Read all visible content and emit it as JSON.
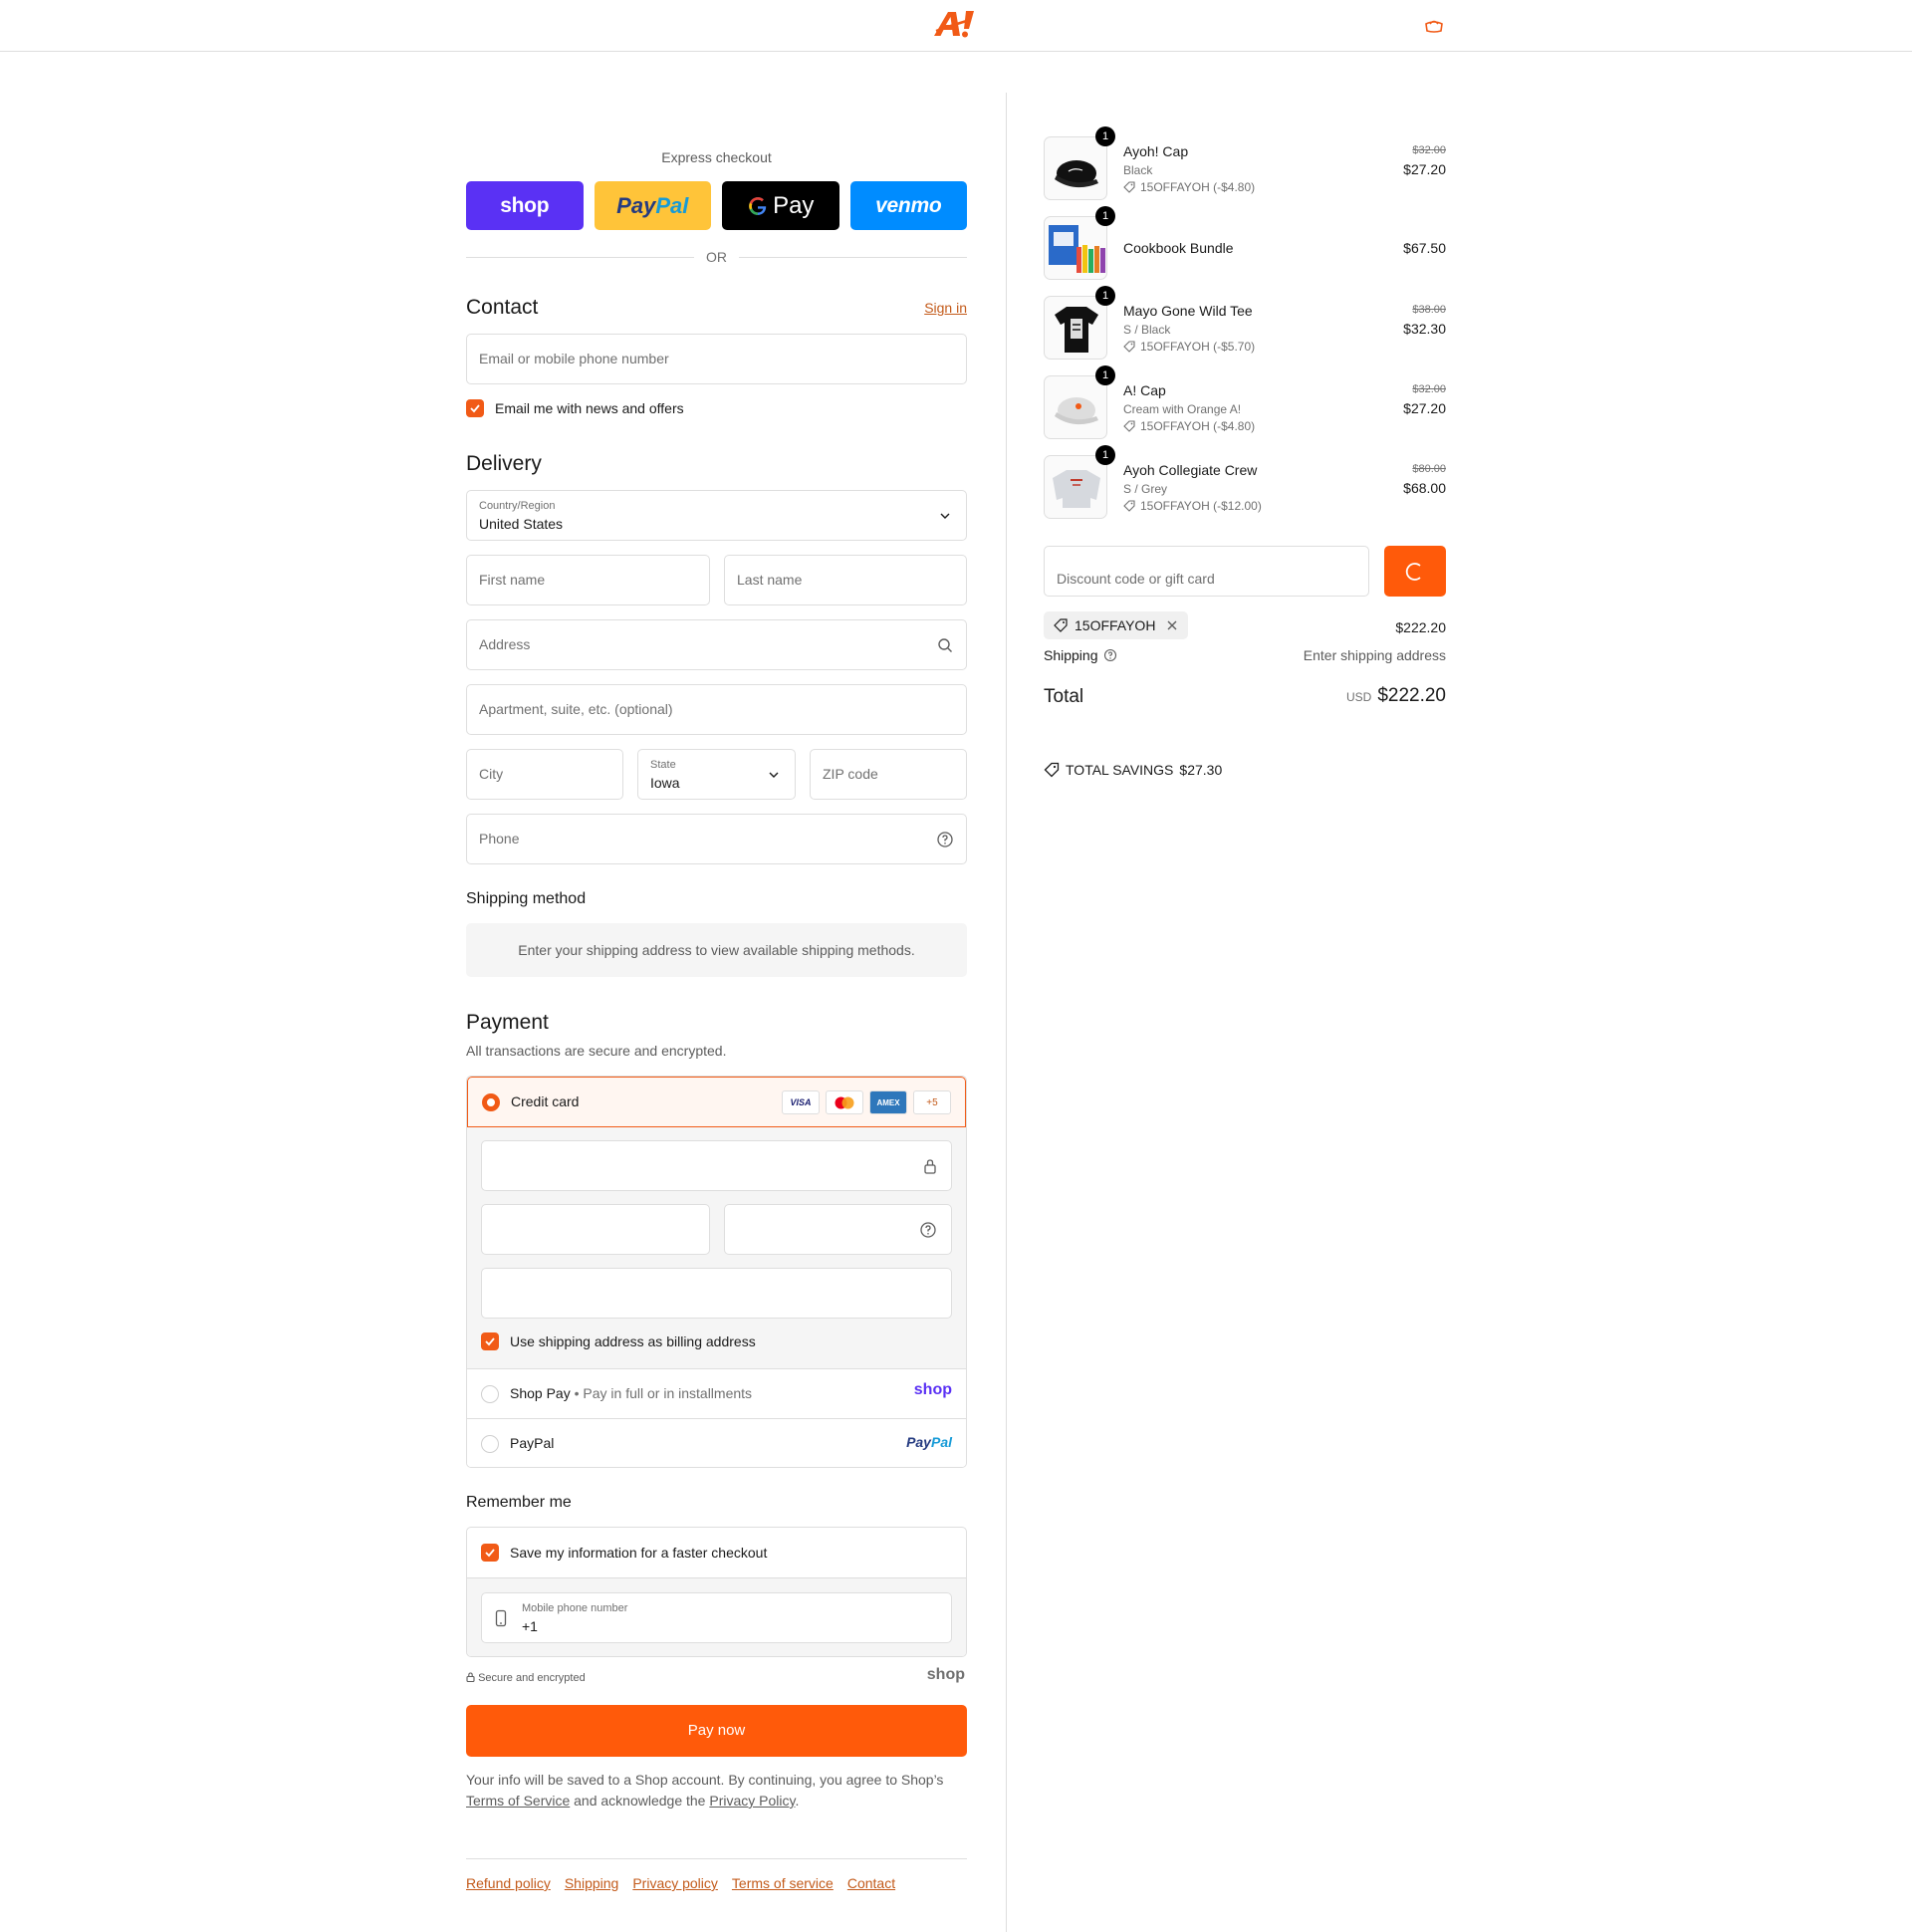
{
  "header": {
    "logo_text": "A!",
    "brand_color": "#f15a16"
  },
  "express": {
    "title": "Express checkout",
    "shop_label": "shop",
    "paypal_label_a": "Pay",
    "paypal_label_b": "Pal",
    "gpay_label": "Pay",
    "venmo_label": "venmo",
    "or_label": "OR"
  },
  "contact": {
    "heading": "Contact",
    "signin": "Sign in",
    "email_placeholder": "Email or mobile phone number",
    "news_label": "Email me with news and offers"
  },
  "delivery": {
    "heading": "Delivery",
    "country_label": "Country/Region",
    "country_value": "United States",
    "first_name": "First name",
    "last_name": "Last name",
    "address": "Address",
    "apartment": "Apartment, suite, etc. (optional)",
    "city": "City",
    "state_label": "State",
    "state_value": "Iowa",
    "zip": "ZIP code",
    "phone": "Phone"
  },
  "shipping_method": {
    "heading": "Shipping method",
    "message": "Enter your shipping address to view available shipping methods."
  },
  "payment": {
    "heading": "Payment",
    "subheading": "All transactions are secure and encrypted.",
    "credit_card": "Credit card",
    "card_more": "+5",
    "billing_label": "Use shipping address as billing address",
    "shop_pay": "Shop Pay",
    "shop_pay_sub": "Pay in full or in installments",
    "shop_logo": "shop",
    "paypal": "PayPal",
    "paypal_logo_a": "Pay",
    "paypal_logo_b": "Pal"
  },
  "remember": {
    "heading": "Remember me",
    "save_label": "Save my information for a faster checkout",
    "mobile_label": "Mobile phone number",
    "mobile_value": "+1"
  },
  "secure_text": "Secure and encrypted",
  "secure_logo": "shop",
  "pay_now": "Pay now",
  "legal": {
    "text_a": "Your info will be saved to a Shop account. By continuing, you agree to Shop’s ",
    "tos": "Terms of Service",
    "text_b": " and acknowledge the ",
    "privacy": "Privacy Policy",
    "text_c": "."
  },
  "footer": {
    "links": [
      "Refund policy",
      "Shipping",
      "Privacy policy",
      "Terms of service",
      "Contact"
    ]
  },
  "order": {
    "items": [
      {
        "name": "Ayoh! Cap",
        "variant": "Black",
        "discount": "15OFFAYOH (-$4.80)",
        "old_price": "$32.00",
        "price": "$27.20",
        "qty": "1"
      },
      {
        "name": "Cookbook Bundle",
        "variant": "",
        "discount": "",
        "old_price": "",
        "price": "$67.50",
        "qty": "1"
      },
      {
        "name": "Mayo Gone Wild Tee",
        "variant": "S / Black",
        "discount": "15OFFAYOH (-$5.70)",
        "old_price": "$38.00",
        "price": "$32.30",
        "qty": "1"
      },
      {
        "name": "A! Cap",
        "variant": "Cream with Orange A!",
        "discount": "15OFFAYOH (-$4.80)",
        "old_price": "$32.00",
        "price": "$27.20",
        "qty": "1"
      },
      {
        "name": "Ayoh Collegiate Crew",
        "variant": "S / Grey",
        "discount": "15OFFAYOH (-$12.00)",
        "old_price": "$80.00",
        "price": "$68.00",
        "qty": "1"
      }
    ],
    "discount_placeholder": "Discount code or gift card",
    "applied_code": "15OFFAYOH",
    "subtotal": "$222.20",
    "shipping_label": "Shipping",
    "shipping_value": "Enter shipping address",
    "total_label": "Total",
    "currency": "USD",
    "total": "$222.20",
    "savings_label": "TOTAL SAVINGS",
    "savings_value": "$27.30"
  }
}
